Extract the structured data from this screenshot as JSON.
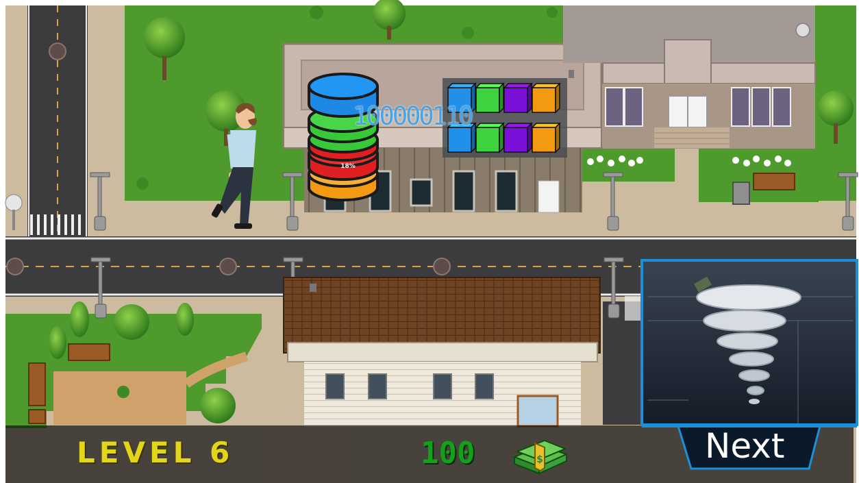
{
  "hud": {
    "level_label": "LEVEL 6",
    "money": "100",
    "money_icon": "cash-stack-icon"
  },
  "database": {
    "percent": "18%",
    "binary": "100000110",
    "layer_colors": [
      "#1e88e5",
      "#38c938",
      "#e02020",
      "#f39a12"
    ]
  },
  "blocks": {
    "colors": [
      "#2090e8",
      "#3ed33e",
      "#7b10d8",
      "#f39a12"
    ]
  },
  "next": {
    "label": "Next",
    "preview_icon": "tornado-icon",
    "accent": "#1c8fd8"
  },
  "character": "walking-man",
  "colors": {
    "grass": "#4f9a2d",
    "road": "#3c3c3e",
    "sidewalk": "#cdbba0",
    "hud_level": "#e3d619",
    "hud_money": "#13a01a"
  }
}
